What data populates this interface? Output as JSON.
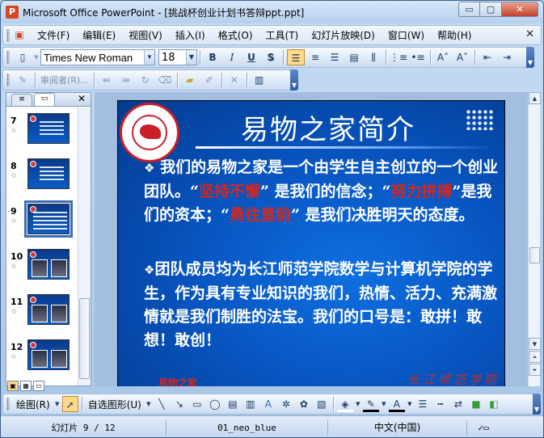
{
  "window": {
    "title": "Microsoft Office PowerPoint - [挑战杯创业计划书答辩ppt.ppt]",
    "app_icon_glyph": "P",
    "minimize_glyph": "▭",
    "maximize_glyph": "▢",
    "close_glyph": "✕"
  },
  "menu": {
    "items": [
      "文件(F)",
      "编辑(E)",
      "视图(V)",
      "插入(I)",
      "格式(O)",
      "工具(T)",
      "幻灯片放映(D)",
      "窗口(W)",
      "帮助(H)"
    ],
    "close_glyph": "✕"
  },
  "format_toolbar": {
    "font_name": "Times New Roman",
    "font_size": "18",
    "bold": "B",
    "italic": "I",
    "underline": "U",
    "shadow": "S",
    "increase_font": "A˄",
    "decrease_font": "A˅"
  },
  "reviewing_toolbar": {
    "reviewer_label": "审阅者(R)..."
  },
  "slides_pane": {
    "thumbnails": [
      {
        "number": "7",
        "kind": "text"
      },
      {
        "number": "8",
        "kind": "text"
      },
      {
        "number": "9",
        "kind": "text",
        "selected": true
      },
      {
        "number": "10",
        "kind": "photos"
      },
      {
        "number": "11",
        "kind": "photos"
      },
      {
        "number": "12",
        "kind": "photos"
      }
    ],
    "star_glyph": "☆",
    "close_glyph": "✕"
  },
  "slide": {
    "title": "易物之家简介",
    "bullet_glyph": "❖",
    "para1": {
      "lead": "  我们的易物之家是一个由学生自主创立的一个创业团队。“",
      "red1": "坚持不懈",
      "mid1": "” 是我们的信念；“",
      "red2": "努力拼搏",
      "mid2": "”是我们的资本；“",
      "red3": "勇往直前",
      "tail": "” 是我们决胜明天的态度。"
    },
    "para2": "团队成员均为长江师范学院数学与计算机学院的学生，作为具有专业知识的我们，热情、活力、充满激情就是我们制胜的法宝。我们的口号是：敢拼！敢想！敢创！",
    "footer_left": "易物之家",
    "footer_sign": "长江师范学院"
  },
  "draw_toolbar": {
    "draw_label": "绘图(R)",
    "autoshape_label": "自选图形(U)"
  },
  "statusbar": {
    "slide_info": "幻灯片 9 / 12",
    "design": "01_neo_blue",
    "language": "中文(中国)"
  },
  "colors": {
    "slide_bg": "#0856c2",
    "accent_red": "#d2281f",
    "window_frame": "#a9c6e8"
  }
}
